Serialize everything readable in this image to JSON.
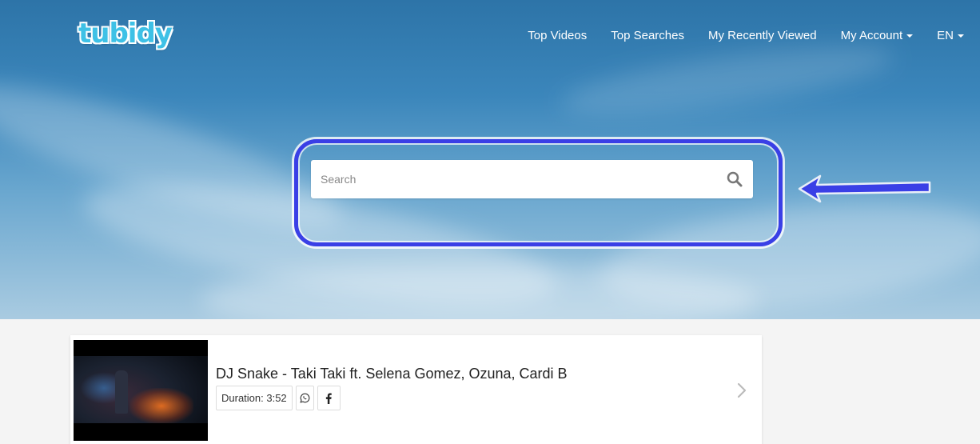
{
  "header": {
    "logo_text": "tubidy",
    "nav": [
      {
        "label": "Top Videos",
        "dropdown": false
      },
      {
        "label": "Top Searches",
        "dropdown": false
      },
      {
        "label": "My Recently Viewed",
        "dropdown": false
      },
      {
        "label": "My Account",
        "dropdown": true
      },
      {
        "label": "EN",
        "dropdown": true
      }
    ]
  },
  "search": {
    "placeholder": "Search",
    "icon": "search-icon"
  },
  "annotation": {
    "highlight_color": "#3a3fe6",
    "arrow_direction": "left"
  },
  "results": [
    {
      "title": "DJ Snake - Taki Taki ft. Selena Gomez, Ozuna, Cardi B",
      "duration": "Duration: 3:52",
      "share_icons": [
        "whatsapp-icon",
        "facebook-icon"
      ]
    }
  ],
  "colors": {
    "logo": "#3ec1e6",
    "nav_text": "#ffffff"
  }
}
